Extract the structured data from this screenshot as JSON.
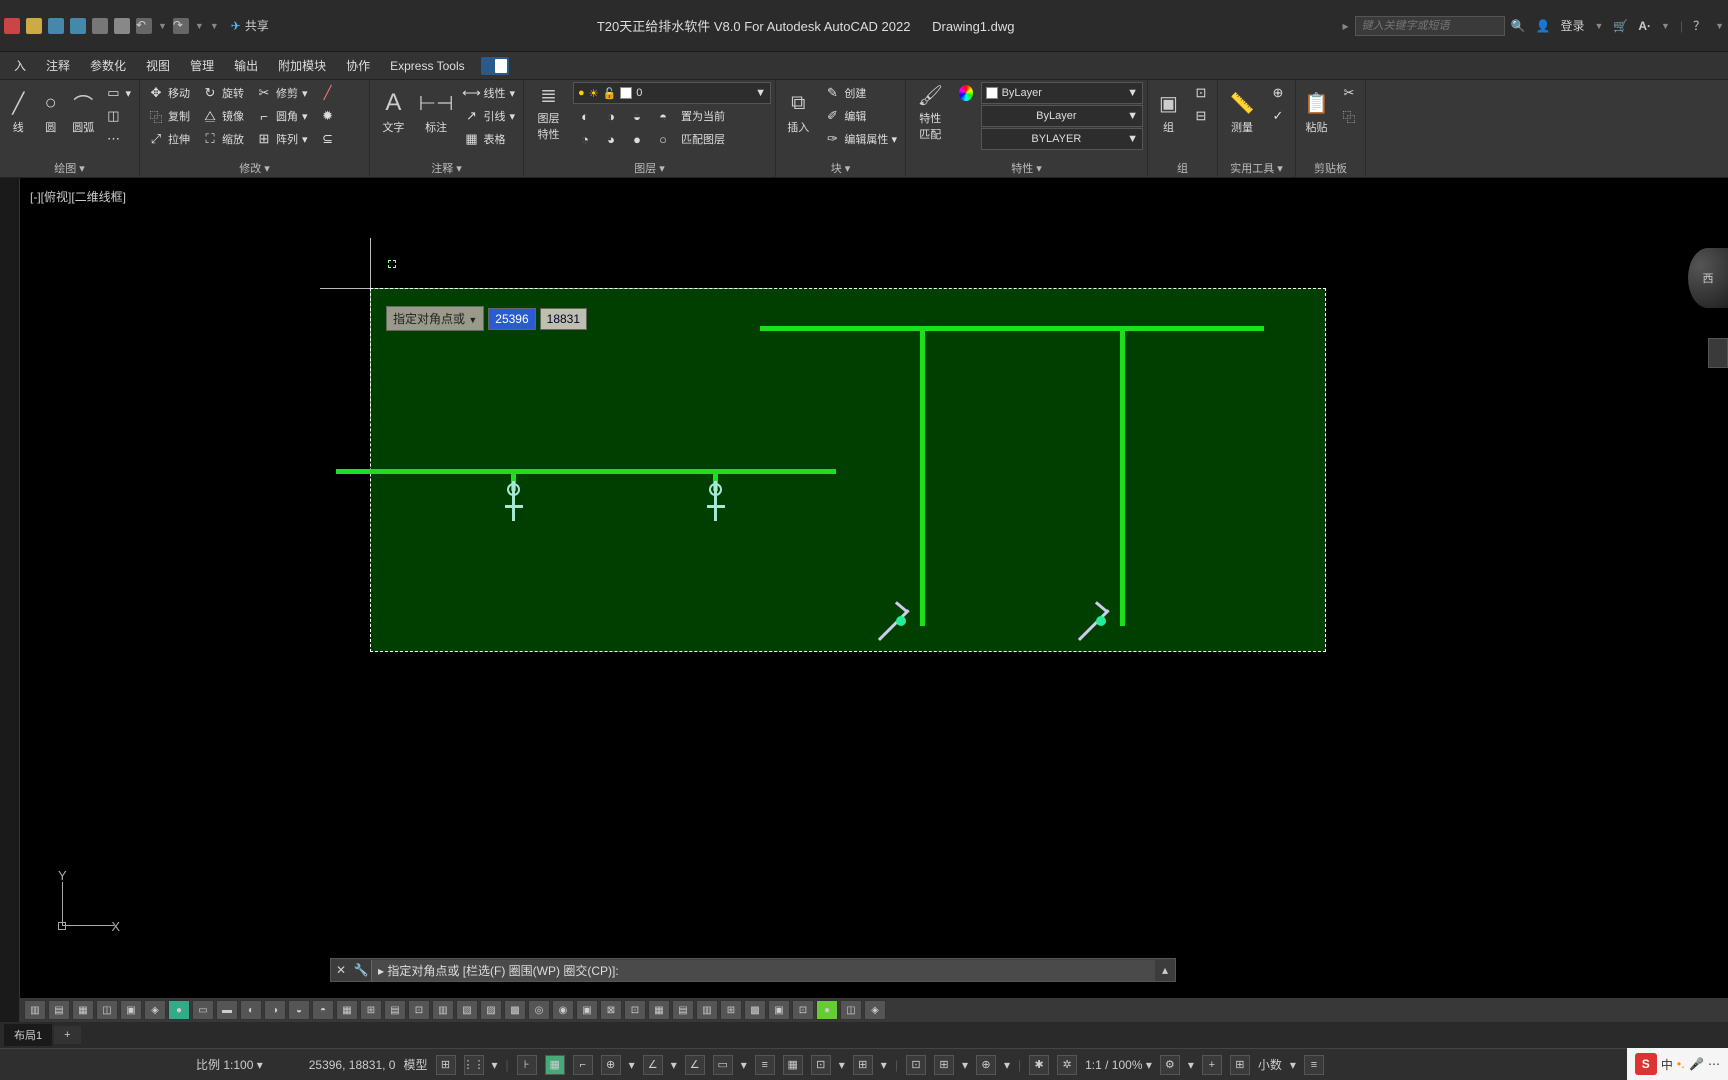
{
  "titlebar": {
    "share": "共享",
    "app_title": "T20天正给排水软件 V8.0 For Autodesk AutoCAD 2022",
    "doc_title": "Drawing1.dwg",
    "search_placeholder": "键入关键字或短语",
    "login": "登录"
  },
  "tabs": {
    "items": [
      "入",
      "注释",
      "参数化",
      "视图",
      "管理",
      "输出",
      "附加模块",
      "协作",
      "Express Tools"
    ]
  },
  "ribbon": {
    "draw": {
      "label": "绘图 ▾",
      "line": "线",
      "circle": "圆",
      "arc": "圆弧"
    },
    "modify": {
      "label": "修改 ▾",
      "move": "移动",
      "rotate": "旋转",
      "trim": "修剪",
      "copy": "复制",
      "mirror": "镜像",
      "fillet": "圆角",
      "stretch": "拉伸",
      "scale": "缩放",
      "array": "阵列"
    },
    "annot": {
      "label": "注释 ▾",
      "text": "文字",
      "dim": "标注",
      "table": "表格",
      "linear": "线性",
      "leader": "引线"
    },
    "layers": {
      "label": "图层 ▾",
      "props": "图层\n特性",
      "current_layer": "0",
      "setcur": "置为当前",
      "match": "匹配图层"
    },
    "block": {
      "label": "块 ▾",
      "insert": "插入",
      "create": "创建",
      "edit": "编辑",
      "attr": "编辑属性 ▾"
    },
    "props": {
      "label": "特性 ▾",
      "match": "特性\n匹配",
      "bylayer1": "ByLayer",
      "bylayer2": "ByLayer",
      "bylayer3": "BYLAYER"
    },
    "group": {
      "label": "组",
      "btn": "组"
    },
    "measure": {
      "label": "实用工具 ▾",
      "btn": "测量"
    },
    "clip": {
      "label": "剪贴板",
      "btn": "粘贴"
    }
  },
  "view": {
    "label": "[-][俯视][二维线框]",
    "cube": "西"
  },
  "dyninput": {
    "prompt": "指定对角点或",
    "x": "25396",
    "y": "18831"
  },
  "cmdline": {
    "text": "指定对角点或 [栏选(F) 圈围(WP) 圈交(CP)]:"
  },
  "layouts": {
    "tab1": "布局1",
    "plus": "+"
  },
  "status": {
    "scale": "比例 1:100 ▾",
    "coords": "25396, 18831, 0",
    "model": "模型",
    "annoscale": "1:1 / 100% ▾",
    "decimal": "小数",
    "ime": "中"
  }
}
